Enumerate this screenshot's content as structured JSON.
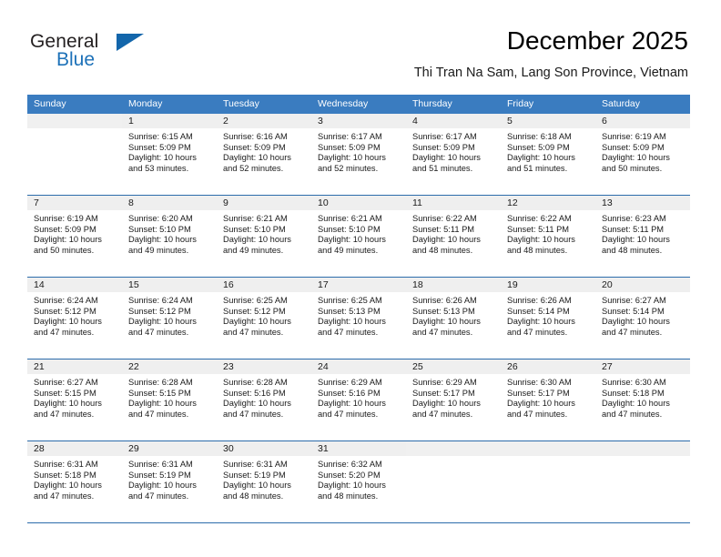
{
  "brand": {
    "word_one": "General",
    "word_two": "Blue",
    "flag_icon": "triangle-flag-icon"
  },
  "header": {
    "title": "December 2025",
    "subtitle": "Thi Tran Na Sam, Lang Son Province, Vietnam"
  },
  "colors": {
    "header_blue": "#3a7cc0",
    "row_rule_blue": "#2c6cab",
    "date_band_gray": "#efefef",
    "brand_blue": "#1d71b8",
    "flag_blue": "#1366ab",
    "text": "#1a1a1a"
  },
  "weekdays": [
    "Sunday",
    "Monday",
    "Tuesday",
    "Wednesday",
    "Thursday",
    "Friday",
    "Saturday"
  ],
  "labels": {
    "sunrise_prefix": "Sunrise:",
    "sunset_prefix": "Sunset:",
    "daylight_prefix": "Daylight:"
  },
  "weeks": [
    [
      {
        "date": "",
        "lines": []
      },
      {
        "date": "1",
        "lines": [
          "Sunrise: 6:15 AM",
          "Sunset: 5:09 PM",
          "Daylight: 10 hours and 53 minutes."
        ]
      },
      {
        "date": "2",
        "lines": [
          "Sunrise: 6:16 AM",
          "Sunset: 5:09 PM",
          "Daylight: 10 hours and 52 minutes."
        ]
      },
      {
        "date": "3",
        "lines": [
          "Sunrise: 6:17 AM",
          "Sunset: 5:09 PM",
          "Daylight: 10 hours and 52 minutes."
        ]
      },
      {
        "date": "4",
        "lines": [
          "Sunrise: 6:17 AM",
          "Sunset: 5:09 PM",
          "Daylight: 10 hours and 51 minutes."
        ]
      },
      {
        "date": "5",
        "lines": [
          "Sunrise: 6:18 AM",
          "Sunset: 5:09 PM",
          "Daylight: 10 hours and 51 minutes."
        ]
      },
      {
        "date": "6",
        "lines": [
          "Sunrise: 6:19 AM",
          "Sunset: 5:09 PM",
          "Daylight: 10 hours and 50 minutes."
        ]
      }
    ],
    [
      {
        "date": "7",
        "lines": [
          "Sunrise: 6:19 AM",
          "Sunset: 5:09 PM",
          "Daylight: 10 hours and 50 minutes."
        ]
      },
      {
        "date": "8",
        "lines": [
          "Sunrise: 6:20 AM",
          "Sunset: 5:10 PM",
          "Daylight: 10 hours and 49 minutes."
        ]
      },
      {
        "date": "9",
        "lines": [
          "Sunrise: 6:21 AM",
          "Sunset: 5:10 PM",
          "Daylight: 10 hours and 49 minutes."
        ]
      },
      {
        "date": "10",
        "lines": [
          "Sunrise: 6:21 AM",
          "Sunset: 5:10 PM",
          "Daylight: 10 hours and 49 minutes."
        ]
      },
      {
        "date": "11",
        "lines": [
          "Sunrise: 6:22 AM",
          "Sunset: 5:11 PM",
          "Daylight: 10 hours and 48 minutes."
        ]
      },
      {
        "date": "12",
        "lines": [
          "Sunrise: 6:22 AM",
          "Sunset: 5:11 PM",
          "Daylight: 10 hours and 48 minutes."
        ]
      },
      {
        "date": "13",
        "lines": [
          "Sunrise: 6:23 AM",
          "Sunset: 5:11 PM",
          "Daylight: 10 hours and 48 minutes."
        ]
      }
    ],
    [
      {
        "date": "14",
        "lines": [
          "Sunrise: 6:24 AM",
          "Sunset: 5:12 PM",
          "Daylight: 10 hours and 47 minutes."
        ]
      },
      {
        "date": "15",
        "lines": [
          "Sunrise: 6:24 AM",
          "Sunset: 5:12 PM",
          "Daylight: 10 hours and 47 minutes."
        ]
      },
      {
        "date": "16",
        "lines": [
          "Sunrise: 6:25 AM",
          "Sunset: 5:12 PM",
          "Daylight: 10 hours and 47 minutes."
        ]
      },
      {
        "date": "17",
        "lines": [
          "Sunrise: 6:25 AM",
          "Sunset: 5:13 PM",
          "Daylight: 10 hours and 47 minutes."
        ]
      },
      {
        "date": "18",
        "lines": [
          "Sunrise: 6:26 AM",
          "Sunset: 5:13 PM",
          "Daylight: 10 hours and 47 minutes."
        ]
      },
      {
        "date": "19",
        "lines": [
          "Sunrise: 6:26 AM",
          "Sunset: 5:14 PM",
          "Daylight: 10 hours and 47 minutes."
        ]
      },
      {
        "date": "20",
        "lines": [
          "Sunrise: 6:27 AM",
          "Sunset: 5:14 PM",
          "Daylight: 10 hours and 47 minutes."
        ]
      }
    ],
    [
      {
        "date": "21",
        "lines": [
          "Sunrise: 6:27 AM",
          "Sunset: 5:15 PM",
          "Daylight: 10 hours and 47 minutes."
        ]
      },
      {
        "date": "22",
        "lines": [
          "Sunrise: 6:28 AM",
          "Sunset: 5:15 PM",
          "Daylight: 10 hours and 47 minutes."
        ]
      },
      {
        "date": "23",
        "lines": [
          "Sunrise: 6:28 AM",
          "Sunset: 5:16 PM",
          "Daylight: 10 hours and 47 minutes."
        ]
      },
      {
        "date": "24",
        "lines": [
          "Sunrise: 6:29 AM",
          "Sunset: 5:16 PM",
          "Daylight: 10 hours and 47 minutes."
        ]
      },
      {
        "date": "25",
        "lines": [
          "Sunrise: 6:29 AM",
          "Sunset: 5:17 PM",
          "Daylight: 10 hours and 47 minutes."
        ]
      },
      {
        "date": "26",
        "lines": [
          "Sunrise: 6:30 AM",
          "Sunset: 5:17 PM",
          "Daylight: 10 hours and 47 minutes."
        ]
      },
      {
        "date": "27",
        "lines": [
          "Sunrise: 6:30 AM",
          "Sunset: 5:18 PM",
          "Daylight: 10 hours and 47 minutes."
        ]
      }
    ],
    [
      {
        "date": "28",
        "lines": [
          "Sunrise: 6:31 AM",
          "Sunset: 5:18 PM",
          "Daylight: 10 hours and 47 minutes."
        ]
      },
      {
        "date": "29",
        "lines": [
          "Sunrise: 6:31 AM",
          "Sunset: 5:19 PM",
          "Daylight: 10 hours and 47 minutes."
        ]
      },
      {
        "date": "30",
        "lines": [
          "Sunrise: 6:31 AM",
          "Sunset: 5:19 PM",
          "Daylight: 10 hours and 48 minutes."
        ]
      },
      {
        "date": "31",
        "lines": [
          "Sunrise: 6:32 AM",
          "Sunset: 5:20 PM",
          "Daylight: 10 hours and 48 minutes."
        ]
      },
      {
        "date": "",
        "lines": []
      },
      {
        "date": "",
        "lines": []
      },
      {
        "date": "",
        "lines": []
      }
    ]
  ]
}
